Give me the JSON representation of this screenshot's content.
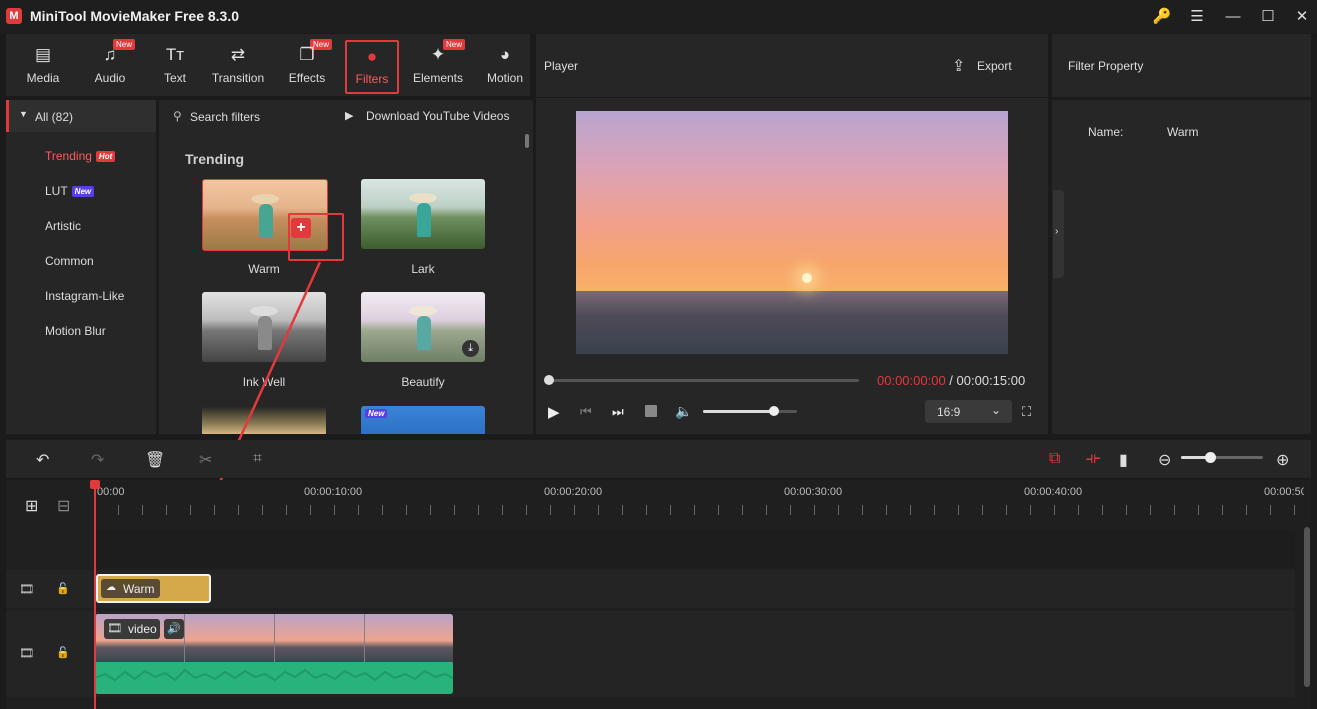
{
  "app": {
    "title": "MiniTool MovieMaker Free 8.3.0",
    "logo_text": "M"
  },
  "window_controls": {
    "key": "🔑",
    "menu": "☰",
    "minimize": "—",
    "maximize": "☐",
    "close": "✕"
  },
  "toolbar": {
    "items": [
      {
        "label": "Media",
        "icon": "▤",
        "badge": ""
      },
      {
        "label": "Audio",
        "icon": "♫",
        "badge": "New"
      },
      {
        "label": "Text",
        "icon": "Tт",
        "badge": ""
      },
      {
        "label": "Transition",
        "icon": "⇄",
        "badge": ""
      },
      {
        "label": "Effects",
        "icon": "❐",
        "badge": "New"
      },
      {
        "label": "Filters",
        "icon": "●",
        "badge": ""
      },
      {
        "label": "Elements",
        "icon": "✦",
        "badge": "New"
      },
      {
        "label": "Motion",
        "icon": "◕",
        "badge": ""
      }
    ]
  },
  "categories": {
    "all": "All (82)",
    "items": [
      {
        "label": "Trending",
        "tag": "Hot"
      },
      {
        "label": "LUT",
        "tag": "New"
      },
      {
        "label": "Artistic",
        "tag": ""
      },
      {
        "label": "Common",
        "tag": ""
      },
      {
        "label": "Instagram-Like",
        "tag": ""
      },
      {
        "label": "Motion Blur",
        "tag": ""
      }
    ]
  },
  "filters_panel": {
    "search_placeholder": "Search filters",
    "download_link": "Download YouTube Videos",
    "section_title": "Trending",
    "thumbs": [
      {
        "label": "Warm"
      },
      {
        "label": "Lark"
      },
      {
        "label": "Ink Well"
      },
      {
        "label": "Beautify"
      }
    ],
    "new_tag": "New"
  },
  "player": {
    "title": "Player",
    "export_label": "Export",
    "current_time": "00:00:00:00",
    "separator": " / ",
    "total_time": "00:00:15:00",
    "aspect": "16:9",
    "progress": 0,
    "volume": 0.75
  },
  "property": {
    "title": "Filter Property",
    "name_label": "Name:",
    "name_value": "Warm"
  },
  "timeline": {
    "ruler": [
      "00:00",
      "00:00:10:00",
      "00:00:20:00",
      "00:00:30:00",
      "00:00:40:00",
      "00:00:50"
    ],
    "filter_clip_label": "Warm",
    "video_clip_label": "video",
    "zoom": 0.35
  },
  "colors": {
    "accent": "#e2393c",
    "filter_clip": "#d5a94a",
    "audio_wave": "#27b37a"
  }
}
